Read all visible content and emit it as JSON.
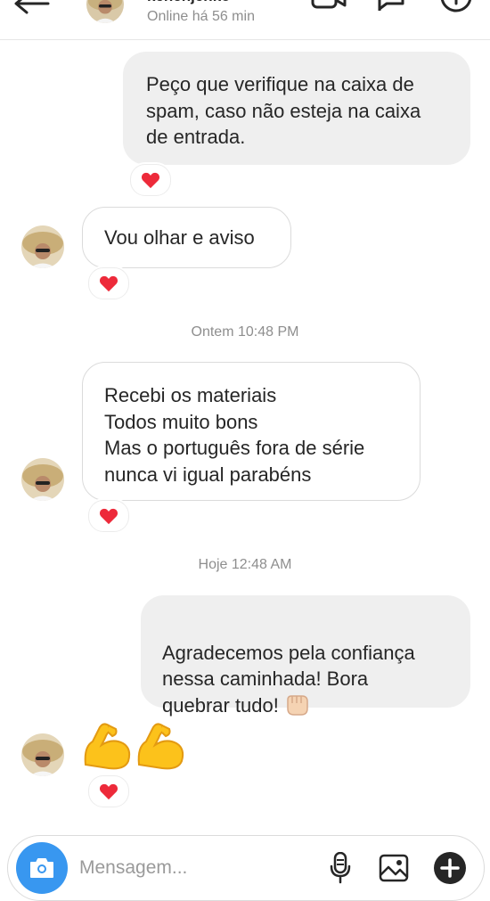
{
  "header": {
    "contact_name": "kenenjenko",
    "status": "Online há 56 min"
  },
  "messages": [
    {
      "text": "Peço que verifique na caixa de\nspam, caso não esteja na caixa\nde entrada.",
      "reaction": "heart"
    },
    {
      "text": "Vou olhar e aviso",
      "reaction": "heart"
    },
    {
      "timestamp": "Ontem 10:48 PM"
    },
    {
      "text": "Recebi os materiais\nTodos muito bons\nMas o português fora de série\nnunca vi igual parabéns",
      "reaction": "heart"
    },
    {
      "timestamp": "Hoje 12:48 AM"
    },
    {
      "text": "Agradecemos pela confiança\nnessa caminhada! Bora\nquebrar tudo! ",
      "emoji": "fist-bump-icon"
    },
    {
      "emoji_message": [
        "flexed-biceps-icon",
        "flexed-biceps-icon"
      ],
      "reaction": "heart"
    }
  ],
  "composer": {
    "placeholder": "Mensagem..."
  },
  "colors": {
    "accent": "#3897f0",
    "heart": "#ed2a3a",
    "outgoing_bubble": "#efefef",
    "secondary_text": "#8e8e8e"
  }
}
